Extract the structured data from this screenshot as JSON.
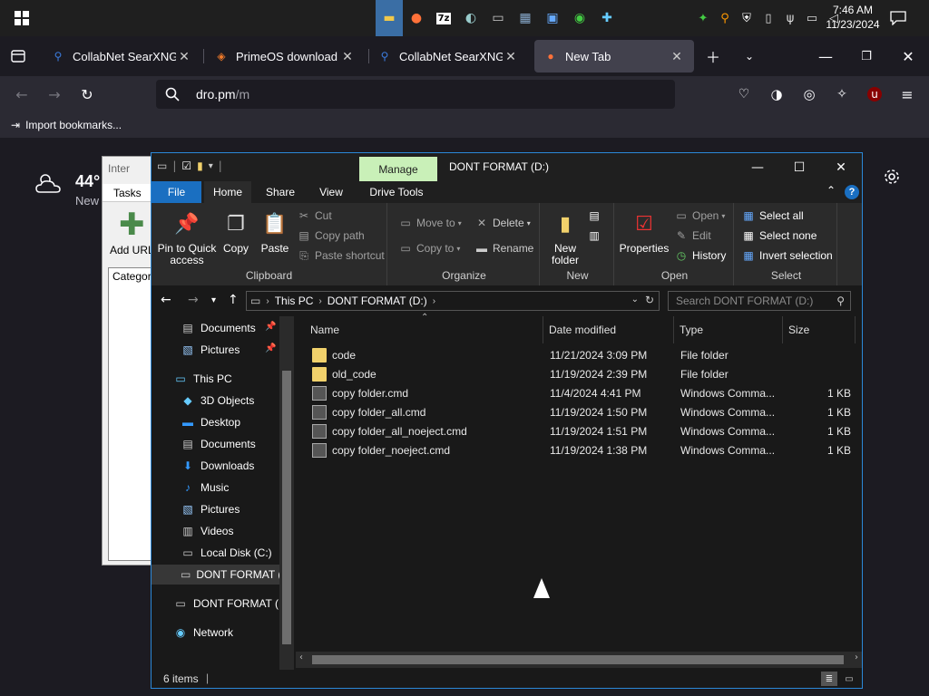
{
  "taskbar": {
    "clock_time": "7:46 AM",
    "clock_date": "11/23/2024",
    "apps": [
      "file-explorer-icon",
      "firefox-icon",
      "7zip-icon",
      "app-icon",
      "terminal-icon",
      "settings-app-icon",
      "window-icon",
      "network-app-icon",
      "tool-icon"
    ],
    "tray": [
      "green-app-icon",
      "search-tray-icon",
      "shield-icon",
      "usb-icon",
      "volume-icon",
      "speaker-icon",
      "network-icon"
    ]
  },
  "browser": {
    "tabs": [
      {
        "label": "CollabNet SearXNG",
        "favicon": "searxng-icon"
      },
      {
        "label": "PrimeOS download | Se",
        "favicon": "primeos-icon"
      },
      {
        "label": "CollabNet SearXNG",
        "favicon": "searxng-icon"
      },
      {
        "label": "New Tab",
        "favicon": "firefox-icon"
      }
    ],
    "url_host": "dro.pm",
    "url_path": "/m",
    "bookmark_label": "Import bookmarks..."
  },
  "newtab": {
    "weather_temp": "44°",
    "weather_loc": "New"
  },
  "bgwindow": {
    "title": "Inter",
    "tasks_label": "Tasks",
    "add_url_label": "Add URL",
    "category_label": "Categor"
  },
  "explorer": {
    "title": "DONT FORMAT (D:)",
    "manage_label": "Manage",
    "ribbon_tabs": [
      "File",
      "Home",
      "Share",
      "View",
      "Drive Tools"
    ],
    "ribbon": {
      "clipboard": {
        "label": "Clipboard",
        "pin": "Pin to Quick access",
        "copy": "Copy",
        "paste": "Paste",
        "cut": "Cut",
        "copy_path": "Copy path",
        "paste_shortcut": "Paste shortcut"
      },
      "organize": {
        "label": "Organize",
        "move_to": "Move to",
        "copy_to": "Copy to",
        "delete": "Delete",
        "rename": "Rename"
      },
      "new": {
        "label": "New",
        "new_folder": "New folder"
      },
      "open": {
        "label": "Open",
        "properties": "Properties",
        "open": "Open",
        "edit": "Edit",
        "history": "History"
      },
      "select": {
        "label": "Select",
        "select_all": "Select all",
        "select_none": "Select none",
        "invert": "Invert selection"
      }
    },
    "address": {
      "crumbs": [
        "This PC",
        "DONT FORMAT (D:)"
      ],
      "search_placeholder": "Search DONT FORMAT (D:)"
    },
    "nav": [
      {
        "label": "Documents",
        "icon": "documents-icon",
        "pinned": true
      },
      {
        "label": "Pictures",
        "icon": "pictures-icon",
        "pinned": true
      },
      {
        "label": "This PC",
        "icon": "this-pc-icon"
      },
      {
        "label": "3D Objects",
        "icon": "3d-objects-icon"
      },
      {
        "label": "Desktop",
        "icon": "desktop-icon"
      },
      {
        "label": "Documents",
        "icon": "documents-icon"
      },
      {
        "label": "Downloads",
        "icon": "downloads-icon"
      },
      {
        "label": "Music",
        "icon": "music-icon"
      },
      {
        "label": "Pictures",
        "icon": "pictures-icon"
      },
      {
        "label": "Videos",
        "icon": "videos-icon"
      },
      {
        "label": "Local Disk (C:)",
        "icon": "drive-icon"
      },
      {
        "label": "DONT FORMAT (",
        "icon": "drive-icon"
      },
      {
        "label": "DONT FORMAT (D",
        "icon": "drive-icon"
      },
      {
        "label": "Network",
        "icon": "network-icon"
      }
    ],
    "columns": [
      "Name",
      "Date modified",
      "Type",
      "Size"
    ],
    "files": [
      {
        "name": "code",
        "date": "11/21/2024 3:09 PM",
        "type": "File folder",
        "size": "",
        "kind": "folder"
      },
      {
        "name": "old_code",
        "date": "11/19/2024 2:39 PM",
        "type": "File folder",
        "size": "",
        "kind": "folder"
      },
      {
        "name": "copy folder.cmd",
        "date": "11/4/2024 4:41 PM",
        "type": "Windows Comma...",
        "size": "1 KB",
        "kind": "cmd"
      },
      {
        "name": "copy folder_all.cmd",
        "date": "11/19/2024 1:50 PM",
        "type": "Windows Comma...",
        "size": "1 KB",
        "kind": "cmd"
      },
      {
        "name": "copy folder_all_noeject.cmd",
        "date": "11/19/2024 1:51 PM",
        "type": "Windows Comma...",
        "size": "1 KB",
        "kind": "cmd"
      },
      {
        "name": "copy folder_noeject.cmd",
        "date": "11/19/2024 1:38 PM",
        "type": "Windows Comma...",
        "size": "1 KB",
        "kind": "cmd"
      }
    ],
    "status": "6 items"
  }
}
